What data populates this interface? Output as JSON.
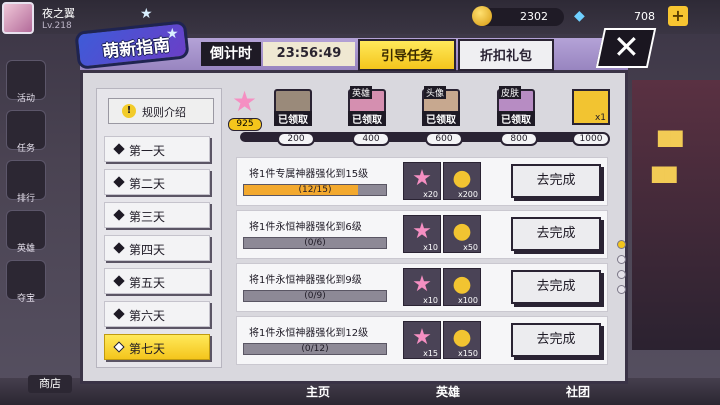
{
  "player": {
    "name": "夜之翼",
    "level": "Lv.218"
  },
  "currency": {
    "coins": "2302",
    "gems": "708"
  },
  "sidebar": [
    {
      "label": "活动",
      "icon": "sparkle-icon"
    },
    {
      "label": "任务",
      "icon": "list-icon"
    },
    {
      "label": "排行",
      "icon": "gate-icon"
    },
    {
      "label": "英雄",
      "icon": "helmet-icon"
    },
    {
      "label": "夺宝",
      "icon": "orb-icon"
    }
  ],
  "bottom_nav": {
    "shop": "商店",
    "home": "主页",
    "heroes": "英雄",
    "community": "社团"
  },
  "modal": {
    "title": "萌新指南",
    "countdown_label": "倒计时",
    "countdown_time": "23:56:49",
    "tabs": [
      {
        "label": "引导任务",
        "active": true
      },
      {
        "label": "折扣礼包",
        "active": false
      }
    ],
    "rules_label": "规则介绍",
    "days": [
      "第一天",
      "第二天",
      "第三天",
      "第四天",
      "第五天",
      "第六天",
      "第七天"
    ],
    "active_day": 6,
    "points": "925",
    "milestones": [
      {
        "value": "200",
        "tag": "",
        "claimed": "已领取"
      },
      {
        "value": "400",
        "tag": "英雄",
        "claimed": "已领取"
      },
      {
        "value": "600",
        "tag": "头像",
        "claimed": "已领取"
      },
      {
        "value": "800",
        "tag": "皮肤",
        "claimed": "已领取"
      },
      {
        "value": "1000",
        "tag": "",
        "claimed": "",
        "reward_count": "x1"
      }
    ],
    "tasks": [
      {
        "name": "将1件专属神器强化到15级",
        "progress": "(12/15)",
        "fraction": 0.8,
        "rewards": [
          {
            "icon": "pink-star-icon",
            "count": "x20"
          },
          {
            "icon": "gold-coin-icon",
            "count": "x200"
          }
        ],
        "action": "去完成"
      },
      {
        "name": "将1件永恒神器强化到6级",
        "progress": "(0/6)",
        "fraction": 0,
        "rewards": [
          {
            "icon": "pink-star-icon",
            "count": "x10"
          },
          {
            "icon": "gold-coin-icon",
            "count": "x50"
          }
        ],
        "action": "去完成"
      },
      {
        "name": "将1件永恒神器强化到9级",
        "progress": "(0/9)",
        "fraction": 0,
        "rewards": [
          {
            "icon": "pink-star-icon",
            "count": "x10"
          },
          {
            "icon": "gold-coin-icon",
            "count": "x100"
          }
        ],
        "action": "去完成"
      },
      {
        "name": "将1件永恒神器强化到12级",
        "progress": "(0/12)",
        "fraction": 0,
        "rewards": [
          {
            "icon": "pink-star-icon",
            "count": "x15"
          },
          {
            "icon": "gold-coin-icon",
            "count": "x150"
          }
        ],
        "action": "去完成"
      }
    ],
    "page_count": 4,
    "page_active": 0
  },
  "colors": {
    "accent": "#f4c51c",
    "progress": "#f3a92e",
    "frame": "#2a2333"
  }
}
